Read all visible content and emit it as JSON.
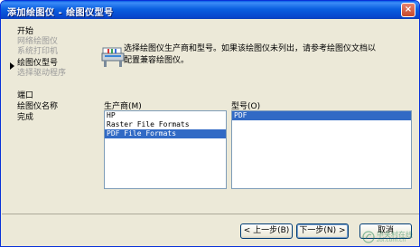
{
  "window": {
    "title": "添加绘图仪 - 绘图仪型号",
    "close_label": "×"
  },
  "sidebar": {
    "steps": [
      {
        "label": "开始",
        "state": "done"
      },
      {
        "label": "网络绘图仪",
        "state": "disabled"
      },
      {
        "label": "系统打印机",
        "state": "disabled"
      },
      {
        "label": "绘图仪型号",
        "state": "current"
      },
      {
        "label": "选择驱动程序",
        "state": "disabled"
      },
      {
        "label": "端口",
        "state": "pending"
      },
      {
        "label": "绘图仪名称",
        "state": "pending"
      },
      {
        "label": "完成",
        "state": "pending"
      }
    ]
  },
  "content": {
    "intro_line1": "选择绘图仪生产商和型号。如果该绘图仪未列出，请参考绘图仪文档以",
    "intro_line2": "配置兼容绘图仪。",
    "manufacturer": {
      "label": "生产商(M)",
      "items": [
        "HP",
        "Raster File Formats",
        "PDF File Formats"
      ],
      "selected_index": 2
    },
    "model": {
      "label": "型号(O)",
      "items": [
        "PDF"
      ],
      "selected_index": 0
    }
  },
  "buttons": {
    "back": "< 上一步(B)",
    "next": "下一步(N) >",
    "cancel": "取消"
  },
  "watermark": {
    "text": "中关村在线",
    "sub": "zol.com.cn"
  },
  "colors": {
    "title_bar": "#0a5fe0",
    "selection": "#316ac5",
    "dialog_bg": "#ece9d8"
  }
}
